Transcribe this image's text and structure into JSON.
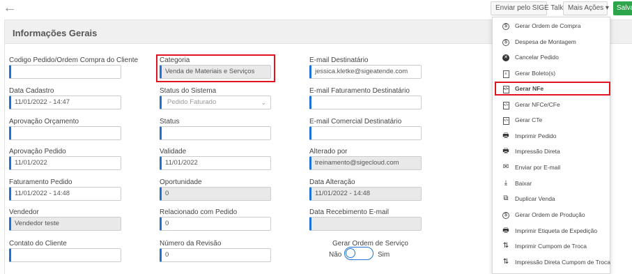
{
  "topbar": {
    "enviar_label": "Enviar pelo SIGE Talk",
    "mais_label": "Mais Ações ▾",
    "salvar_label": "Salvar"
  },
  "panel": {
    "title": "Informações Gerais"
  },
  "col1": [
    {
      "label": "Codigo Pedido/Ordem Compra do Cliente",
      "value": ""
    },
    {
      "label": "Data Cadastro",
      "value": "11/01/2022 - 14:47"
    },
    {
      "label": "Aprovação Orçamento",
      "value": ""
    },
    {
      "label": "Aprovação Pedido",
      "value": "11/01/2022"
    },
    {
      "label": "Faturamento Pedido",
      "value": "11/01/2022 - 14:48"
    },
    {
      "label": "Vendedor",
      "value": "Vendedor teste"
    },
    {
      "label": "Contato do Cliente",
      "value": ""
    }
  ],
  "col2": [
    {
      "label": "Categoria",
      "value": "Venda de Materiais e Serviços"
    },
    {
      "label": "Status do Sistema",
      "value": "Pedido Faturado"
    },
    {
      "label": "Status",
      "value": ""
    },
    {
      "label": "Validade",
      "value": "11/01/2022"
    },
    {
      "label": "Oportunidade",
      "value": "0"
    },
    {
      "label": "Relacionado com Pedido",
      "value": "0"
    },
    {
      "label": "Número da Revisão",
      "value": "0"
    }
  ],
  "col3": [
    {
      "label": "E-mail Destinatário",
      "value": "jessica.kletke@sigeatende.com"
    },
    {
      "label": "E-mail Faturamento Destinatário",
      "value": ""
    },
    {
      "label": "E-mail Comercial Destinatário",
      "value": ""
    },
    {
      "label": "Alterado por",
      "value": "treinamento@sigecloud.com"
    },
    {
      "label": "Data Alteração",
      "value": "11/01/2022 - 14:48"
    },
    {
      "label": "Data Recebimento E-mail",
      "value": ""
    }
  ],
  "toggle": {
    "title": "Gerar Ordem de Serviço",
    "off_label": "Não",
    "on_label": "Sim"
  },
  "menu": [
    {
      "label": "Gerar Ordem de Compra",
      "icon": "dollar-circle-icon",
      "glyph": "$"
    },
    {
      "label": "Despesa de Montagem",
      "icon": "dollar-circle-icon",
      "glyph": "$"
    },
    {
      "label": "Cancelar Pedido",
      "icon": "cancel-icon",
      "glyph": "✕"
    },
    {
      "label": "Gerar Boleto(s)",
      "icon": "document-icon",
      "glyph": "≡"
    },
    {
      "label": "Gerar NFe",
      "icon": "nfe-document-icon",
      "glyph": "</>"
    },
    {
      "label": "Gerar NFCe/CFe",
      "icon": "nfce-document-icon",
      "glyph": "</>"
    },
    {
      "label": "Gerar CTe",
      "icon": "cte-document-icon",
      "glyph": "</>"
    },
    {
      "label": "Imprimir Pedido",
      "icon": "printer-icon",
      "glyph": "🖶"
    },
    {
      "label": "Impressão Direta",
      "icon": "printer-icon",
      "glyph": "🖶"
    },
    {
      "label": "Enviar por E-mail",
      "icon": "envelope-icon",
      "glyph": "✉"
    },
    {
      "label": "Baixar",
      "icon": "download-icon",
      "glyph": "⤓"
    },
    {
      "label": "Duplicar Venda",
      "icon": "duplicate-icon",
      "glyph": "⧉"
    },
    {
      "label": "Gerar Ordem de Produção",
      "icon": "dollar-circle-icon",
      "glyph": "$"
    },
    {
      "label": "Imprimir Etiqueta de Expedição",
      "icon": "printer-icon",
      "glyph": "🖶"
    },
    {
      "label": "Imprimir Cumpom de Troca",
      "icon": "swap-icon",
      "glyph": "⇅"
    },
    {
      "label": "Impressão Direta Cumpom de Troca",
      "icon": "swap-icon",
      "glyph": "⇅"
    }
  ]
}
